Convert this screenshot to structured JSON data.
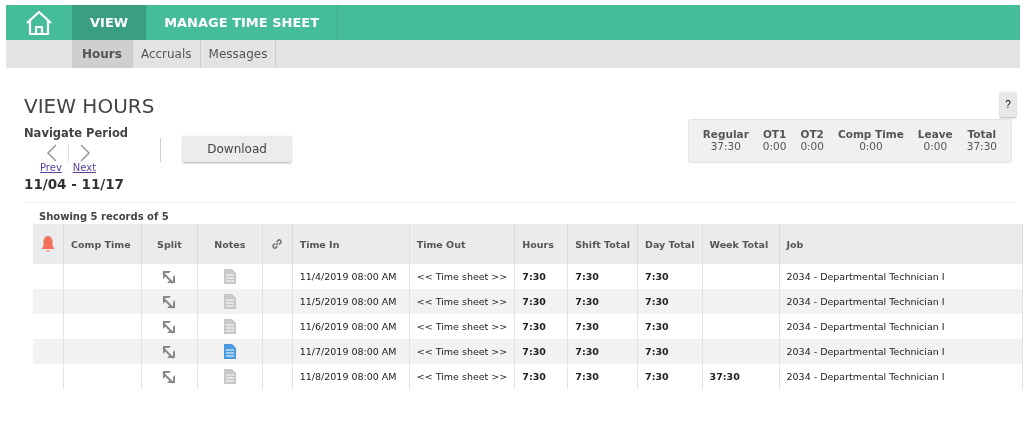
{
  "nav": {
    "tabs": [
      {
        "label": "VIEW",
        "selected": true
      },
      {
        "label": "MANAGE TIME SHEET",
        "selected": false
      }
    ]
  },
  "subnav": {
    "tabs": [
      {
        "label": "Hours",
        "selected": true
      },
      {
        "label": "Accruals",
        "selected": false
      },
      {
        "label": "Messages",
        "selected": false
      }
    ]
  },
  "page_title": "VIEW HOURS",
  "help_button": "?",
  "navigate": {
    "label": "Navigate Period",
    "prev": "Prev",
    "next": "Next",
    "period": "11/04 - 11/17"
  },
  "download_button": "Download",
  "summary": [
    {
      "label": "Regular",
      "value": "37:30"
    },
    {
      "label": "OT1",
      "value": "0:00"
    },
    {
      "label": "OT2",
      "value": "0:00"
    },
    {
      "label": "Comp Time",
      "value": "0:00"
    },
    {
      "label": "Leave",
      "value": "0:00"
    },
    {
      "label": "Total",
      "value": "37:30"
    }
  ],
  "records_info": "Showing 5 records of 5",
  "table": {
    "columns": [
      "Comp Time",
      "Split",
      "Notes",
      "Time In",
      "Time Out",
      "Hours",
      "Shift Total",
      "Day Total",
      "Week Total",
      "Job"
    ],
    "rows": [
      {
        "time_in": "11/4/2019 08:00 AM",
        "time_out": "<< Time sheet >>",
        "hours": "7:30",
        "shift_total": "7:30",
        "day_total": "7:30",
        "job": "2034 - Departmental Technician I",
        "has_note": false
      },
      {
        "time_in": "11/5/2019 08:00 AM",
        "time_out": "<< Time sheet >>",
        "hours": "7:30",
        "shift_total": "7:30",
        "day_total": "7:30",
        "job": "2034 - Departmental Technician I",
        "has_note": false
      },
      {
        "time_in": "11/6/2019 08:00 AM",
        "time_out": "<< Time sheet >>",
        "hours": "7:30",
        "shift_total": "7:30",
        "day_total": "7:30",
        "job": "2034 - Departmental Technician I",
        "has_note": false
      },
      {
        "time_in": "11/7/2019 08:00 AM",
        "time_out": "<< Time sheet >>",
        "hours": "7:30",
        "shift_total": "7:30",
        "day_total": "7:30",
        "job": "2034 - Departmental Technician I",
        "has_note": true
      },
      {
        "time_in": "11/8/2019 08:00 AM",
        "time_out": "<< Time sheet >>",
        "hours": "7:30",
        "shift_total": "7:30",
        "day_total": "7:30",
        "week_total": "37:30",
        "job": "2034 - Departmental Technician I",
        "has_note": false
      }
    ]
  }
}
